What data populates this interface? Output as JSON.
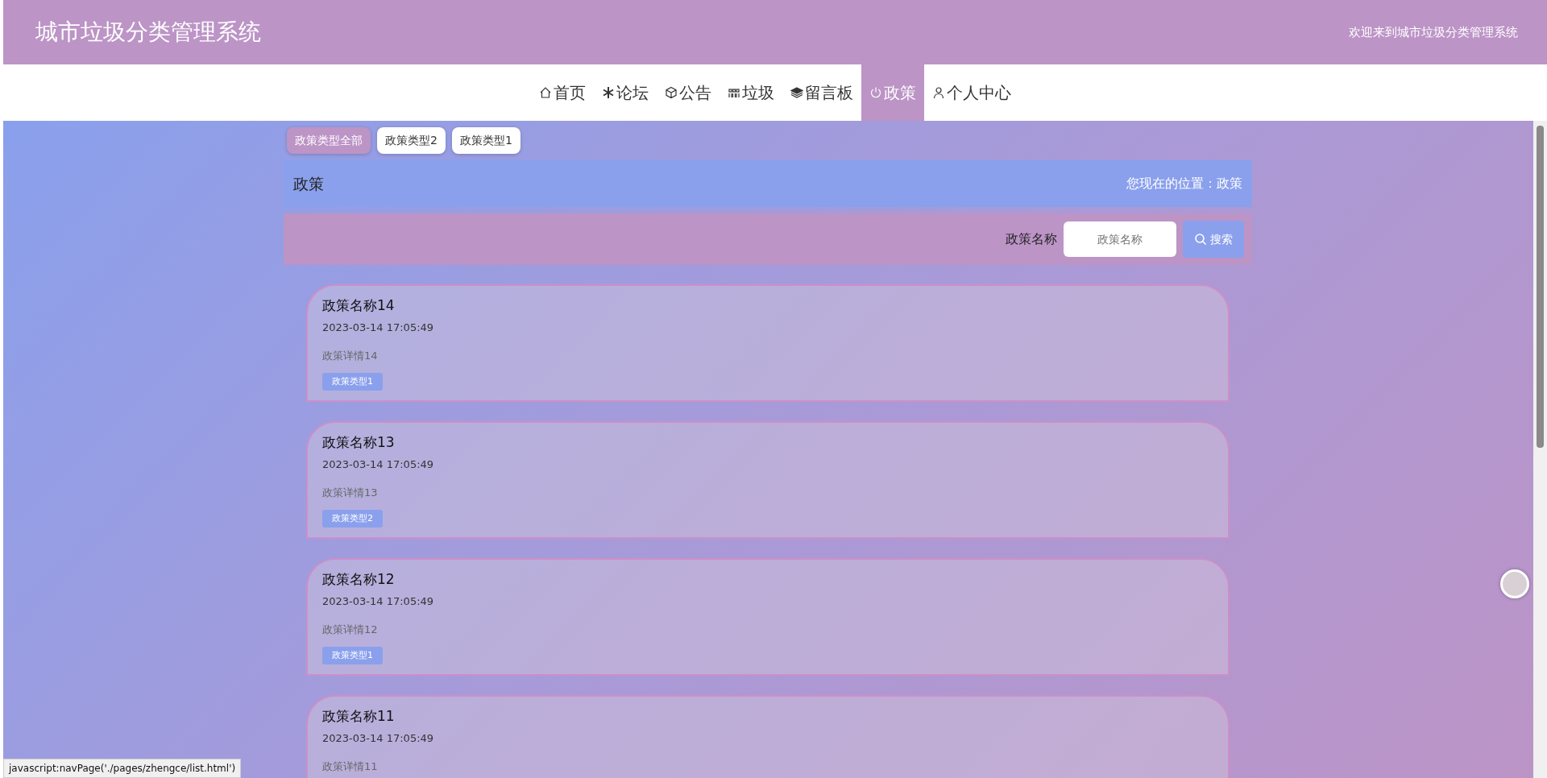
{
  "header": {
    "title": "城市垃圾分类管理系统",
    "welcome": "欢迎来到城市垃圾分类管理系统"
  },
  "nav": [
    {
      "label": "首页",
      "selected": false
    },
    {
      "label": "论坛",
      "selected": false
    },
    {
      "label": "公告",
      "selected": false
    },
    {
      "label": "垃圾",
      "selected": false
    },
    {
      "label": "留言板",
      "selected": false
    },
    {
      "label": "政策",
      "selected": true
    },
    {
      "label": "个人中心",
      "selected": false
    }
  ],
  "filters": [
    {
      "label": "政策类型全部",
      "selected": true
    },
    {
      "label": "政策类型2",
      "selected": false
    },
    {
      "label": "政策类型1",
      "selected": false
    }
  ],
  "breadcrumb": {
    "title": "政策",
    "location": "您现在的位置：政策"
  },
  "search": {
    "label": "政策名称",
    "placeholder": "政策名称",
    "button": "搜索"
  },
  "cards": [
    {
      "title": "政策名称14",
      "time": "2023-03-14 17:05:49",
      "detail": "政策详情14",
      "tag": "政策类型1"
    },
    {
      "title": "政策名称13",
      "time": "2023-03-14 17:05:49",
      "detail": "政策详情13",
      "tag": "政策类型2"
    },
    {
      "title": "政策名称12",
      "time": "2023-03-14 17:05:49",
      "detail": "政策详情12",
      "tag": "政策类型1"
    },
    {
      "title": "政策名称11",
      "time": "2023-03-14 17:05:49",
      "detail": "政策详情11"
    }
  ],
  "status_bar": "javascript:navPage('./pages/zhengce/list.html')"
}
